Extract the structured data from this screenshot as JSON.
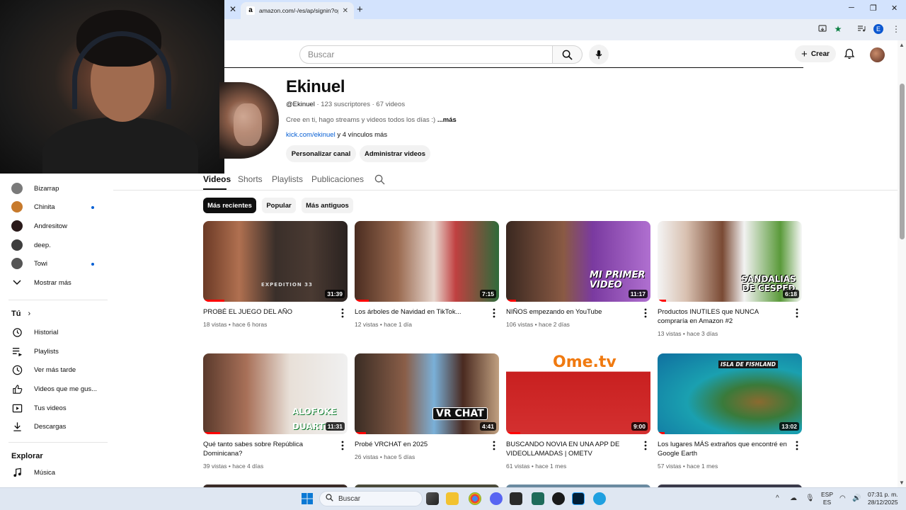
{
  "browser": {
    "active_tab_title": "amazon.com/-/es/ap/signin?op",
    "new_tab_symbol": "+"
  },
  "youtube": {
    "search_placeholder": "Buscar",
    "create_label": "Crear"
  },
  "channel": {
    "name": "Ekinuel",
    "handle": "@Ekinuel",
    "subscribers": "123 suscriptores",
    "videos_count": "67 videos",
    "description": "Cree en ti, hago streams y videos todos los días :)",
    "more": "...más",
    "link": "kick.com/ekinuel",
    "more_links": "y 4 vínculos más",
    "customize_button": "Personalizar canal",
    "manage_button": "Administrar videos"
  },
  "tabs": [
    "Videos",
    "Shorts",
    "Playlists",
    "Publicaciones"
  ],
  "chips": [
    "Más recientes",
    "Popular",
    "Más antiguos"
  ],
  "sidebar": {
    "subscriptions": [
      {
        "label": "Bizarrap",
        "dot": false
      },
      {
        "label": "Chinita",
        "dot": true
      },
      {
        "label": "Andresitow",
        "dot": false
      },
      {
        "label": "deep.",
        "dot": false
      },
      {
        "label": "Towi",
        "dot": true
      }
    ],
    "show_more": "Mostrar más",
    "you_header": "Tú",
    "you_items": [
      "Historial",
      "Playlists",
      "Ver más tarde",
      "Videos que me gus...",
      "Tus videos",
      "Descargas"
    ],
    "explore_header": "Explorar",
    "explore_items": [
      "Música"
    ]
  },
  "videos": [
    {
      "title": "PROBÉ EL JUEGO DEL AÑO",
      "views": "18 vistas",
      "age": "hace 6 horas",
      "duration": "31:39",
      "thumb_text": "EXPEDITION 33"
    },
    {
      "title": "Los árboles de Navidad en TikTok...",
      "views": "12 vistas",
      "age": "hace 1 día",
      "duration": "7:15",
      "thumb_text": ""
    },
    {
      "title": "NIÑOS empezando en YouTube",
      "views": "106 vistas",
      "age": "hace 2 días",
      "duration": "11:17",
      "thumb_text": "MI PRIMER VIDEO"
    },
    {
      "title": "Productos INUTILES que NUNCA compraría en Amazon #2",
      "views": "13 vistas",
      "age": "hace 3 días",
      "duration": "6:18",
      "thumb_text": "SANDALIAS DE CESPED"
    },
    {
      "title": "Qué tanto sabes sobre República Dominicana?",
      "views": "39 vistas",
      "age": "hace 4 días",
      "duration": "11:31",
      "thumb_text": "ALOFOKE DUARTE"
    },
    {
      "title": "Probé VRCHAT en 2025",
      "views": "26 vistas",
      "age": "hace 5 días",
      "duration": "4:41",
      "thumb_text": "VR CHAT"
    },
    {
      "title": "BUSCANDO NOVIA EN UNA APP DE VIDEOLLAMADAS | OMETV",
      "views": "61 vistas",
      "age": "hace 1 mes",
      "duration": "9:00",
      "thumb_text": "Ome.tv"
    },
    {
      "title": "Los lugares MÁS extraños que encontré en Google Earth",
      "views": "57 vistas",
      "age": "hace 1 mes",
      "duration": "13:02",
      "thumb_text": "ISLA DE FISHLAND"
    }
  ],
  "taskbar": {
    "search_label": "Buscar",
    "lang_top": "ESP",
    "lang_bottom": "ES",
    "time": "07:31 p. m.",
    "date": "28/12/2025"
  }
}
